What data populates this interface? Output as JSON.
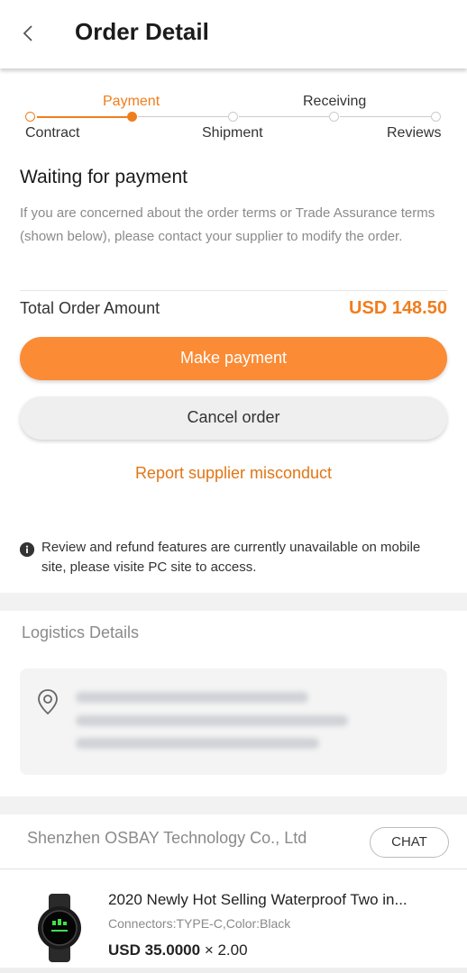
{
  "header": {
    "title": "Order Detail",
    "back_icon": "chevron-left-icon"
  },
  "progress": {
    "steps": [
      {
        "label": "Contract",
        "state": "done"
      },
      {
        "label": "Payment",
        "state": "current"
      },
      {
        "label": "Shipment",
        "state": "pending"
      },
      {
        "label": "Receiving",
        "state": "pending"
      },
      {
        "label": "Reviews",
        "state": "pending"
      }
    ],
    "accent": "#f07d1c"
  },
  "status": {
    "title": "Waiting for payment",
    "description": "If you are concerned about the order terms or Trade Assurance terms (shown below), please contact your supplier to modify the order."
  },
  "order": {
    "total_label": "Total Order Amount",
    "total_value": "USD 148.50"
  },
  "actions": {
    "pay_label": "Make payment",
    "cancel_label": "Cancel order",
    "report_label": "Report supplier misconduct"
  },
  "notice": {
    "icon": "info-icon",
    "text": "Review and refund features are  currently unavailable on mobile site, please visite PC site to access."
  },
  "logistics": {
    "title": "Logistics Details",
    "icon": "location-pin-icon"
  },
  "supplier": {
    "name": "Shenzhen OSBAY Technology Co., Ltd",
    "chat_label": "CHAT"
  },
  "product": {
    "name": "2020 Newly Hot Selling Waterproof Two in...",
    "spec": "Connectors:TYPE-C,Color:Black",
    "price": "USD 35.0000",
    "quantity": "× 2.00"
  },
  "colors": {
    "accent": "#f07d1c",
    "button": "#fb8b34",
    "muted": "#8a8a8a"
  }
}
